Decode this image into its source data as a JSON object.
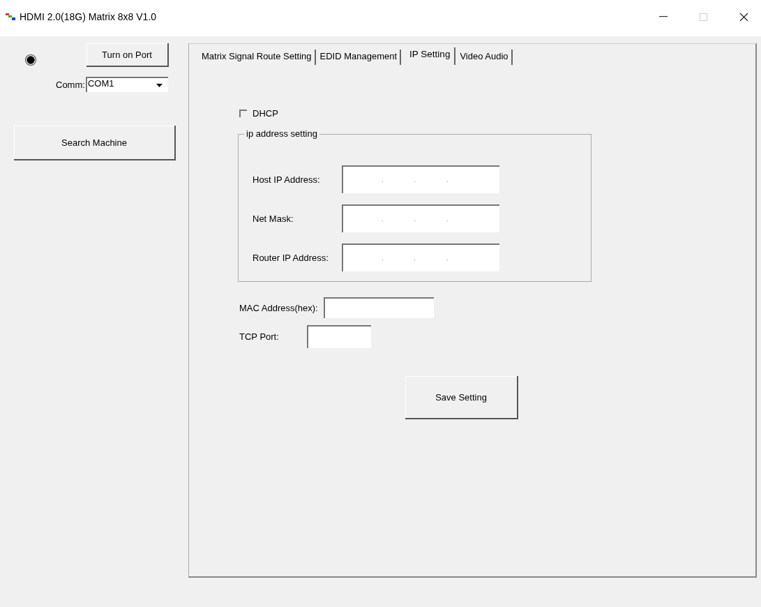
{
  "window": {
    "title": "HDMI 2.0(18G) Matrix 8x8 V1.0"
  },
  "left_panel": {
    "port_indicator": {
      "on": true
    },
    "turn_on_button": "Turn on Port",
    "comm": {
      "label": "Comm:",
      "value": "COM1"
    },
    "search_button": "Search Machine"
  },
  "tabs": [
    {
      "label": "Matrix Signal Route Setting",
      "selected": false
    },
    {
      "label": "EDID Management",
      "selected": false
    },
    {
      "label": "IP Setting",
      "selected": true
    },
    {
      "label": "Video Audio",
      "selected": false
    }
  ],
  "dhcp": {
    "label": "DHCP",
    "checked": false
  },
  "ip_group": {
    "title": "ip address setting",
    "fields": [
      {
        "label": "Host IP Address:",
        "separators": [
          ".",
          ".",
          "."
        ]
      },
      {
        "label": "Net Mask:",
        "separators": [
          ".",
          ".",
          "."
        ]
      },
      {
        "label": "Router IP Address:",
        "separators": [
          ".",
          ".",
          "."
        ]
      }
    ]
  },
  "mac_address": {
    "label": "MAC Address(hex):"
  },
  "tcp_port": {
    "label": "TCP Port:"
  },
  "save_button": "Save Setting"
}
